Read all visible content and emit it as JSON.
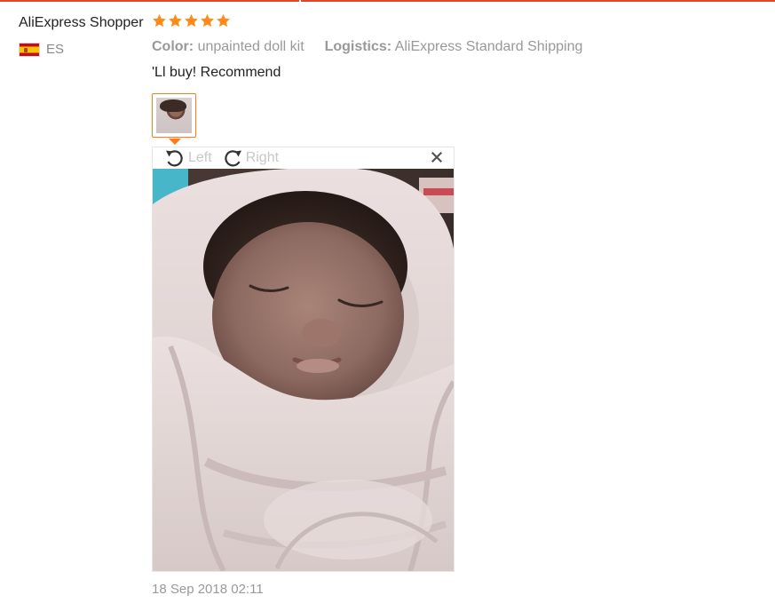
{
  "review": {
    "user_name": "AliExpress Shopper",
    "country_code": "ES",
    "flag_icon": "spain-flag-icon",
    "rating": {
      "value": 5,
      "max": 5,
      "color": "#ff8c1a"
    },
    "color_label": "Color:",
    "color_value": "unpainted doll kit",
    "logistics_label": "Logistics:",
    "logistics_value": "AliExpress Standard Shipping",
    "feedback_text": "'Ll buy! Recommend",
    "date": "18 Sep 2018 02:11"
  },
  "viewer": {
    "rotate_left_label": "Left",
    "rotate_right_label": "Right",
    "rotate_left_icon": "rotate-left-icon",
    "rotate_right_icon": "rotate-right-icon",
    "close_icon": "close-icon"
  },
  "colors": {
    "accent": "#e1452c",
    "thumb_border": "#ff7a1a",
    "muted_text": "#999999"
  }
}
